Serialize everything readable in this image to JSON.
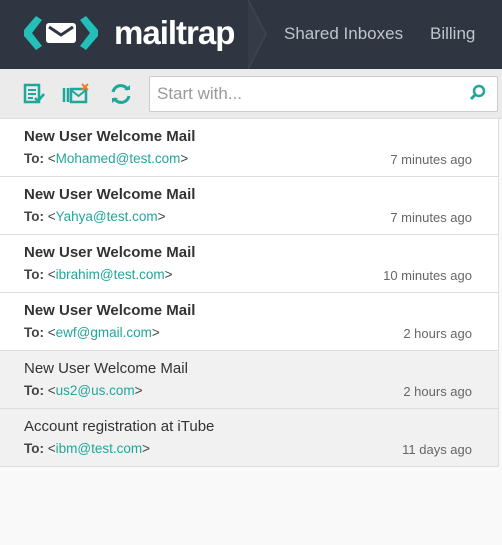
{
  "header": {
    "brand": "mailtrap",
    "nav": [
      "Shared Inboxes",
      "Billing"
    ]
  },
  "toolbar": {
    "search_placeholder": "Start with..."
  },
  "messages": [
    {
      "subject": "New User Welcome Mail",
      "to_label": "To:",
      "email": "Mohamed@test.com",
      "time": "7 minutes ago",
      "read": false
    },
    {
      "subject": "New User Welcome Mail",
      "to_label": "To:",
      "email": "Yahya@test.com",
      "time": "7 minutes ago",
      "read": false
    },
    {
      "subject": "New User Welcome Mail",
      "to_label": "To:",
      "email": "ibrahim@test.com",
      "time": "10 minutes ago",
      "read": false
    },
    {
      "subject": "New User Welcome Mail",
      "to_label": "To:",
      "email": "ewf@gmail.com",
      "time": "2 hours ago",
      "read": false
    },
    {
      "subject": "New User Welcome Mail",
      "to_label": "To:",
      "email": "us2@us.com",
      "time": "2 hours ago",
      "read": true
    },
    {
      "subject": "Account registration at iTube",
      "to_label": "To:",
      "email": "ibm@test.com",
      "time": "11 days ago",
      "read": true
    }
  ]
}
